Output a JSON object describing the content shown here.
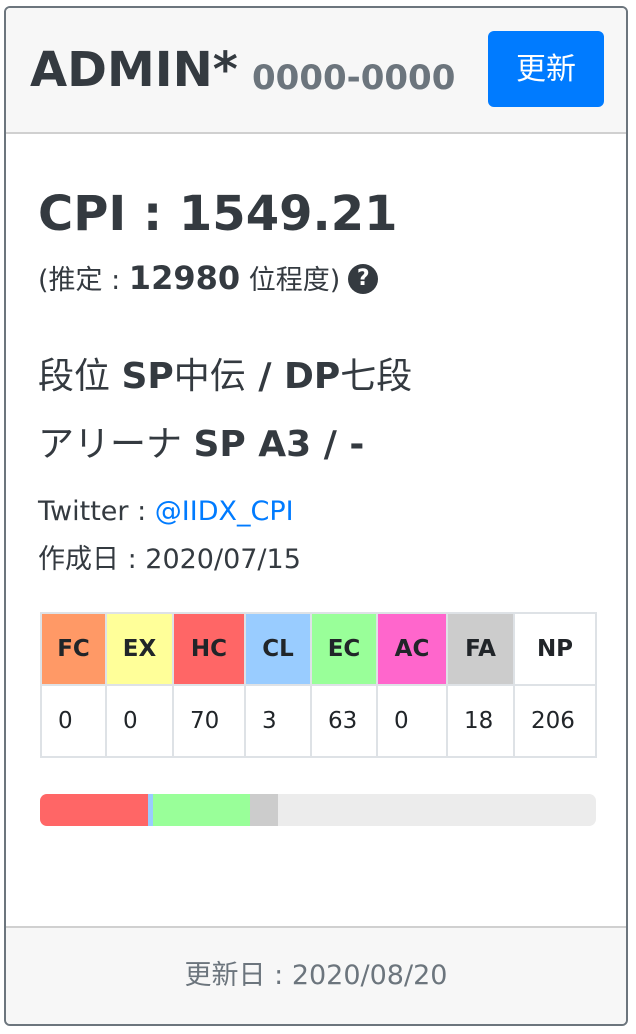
{
  "header": {
    "name": "ADMIN*",
    "id": "0000-0000",
    "update_label": "更新"
  },
  "stats": {
    "cpi_label": "CPI : ",
    "cpi_value": "1549.21",
    "estimate_prefix": "(推定 : ",
    "estimate_rank": "12980",
    "estimate_suffix": " 位程度)",
    "help_icon": "question-circle-icon"
  },
  "profile": {
    "dan_label": "段位 ",
    "dan_sp": "SP",
    "dan_sp_rank": "中伝",
    "dan_sep": " / ",
    "dan_dp": "DP",
    "dan_dp_rank": "七段",
    "arena_label": "アリーナ ",
    "arena_value": "SP A3 / -",
    "twitter_label": "Twitter : ",
    "twitter_handle": "@IIDX_CPI",
    "created_label": "作成日 : ",
    "created_date": "2020/07/15"
  },
  "lamps": [
    {
      "label": "FC",
      "count": "0",
      "color": "#ff9966"
    },
    {
      "label": "EX",
      "count": "0",
      "color": "#ffff99"
    },
    {
      "label": "HC",
      "count": "70",
      "color": "#ff6666"
    },
    {
      "label": "CL",
      "count": "3",
      "color": "#99ccff"
    },
    {
      "label": "EC",
      "count": "63",
      "color": "#99ff99"
    },
    {
      "label": "AC",
      "count": "0",
      "color": "#ff66cc"
    },
    {
      "label": "FA",
      "count": "18",
      "color": "#cccccc"
    },
    {
      "label": "NP",
      "count": "206",
      "color": "#ffffff"
    }
  ],
  "progress_total": 360,
  "footer": {
    "updated_label": "更新日 : ",
    "updated_date": "2020/08/20"
  }
}
